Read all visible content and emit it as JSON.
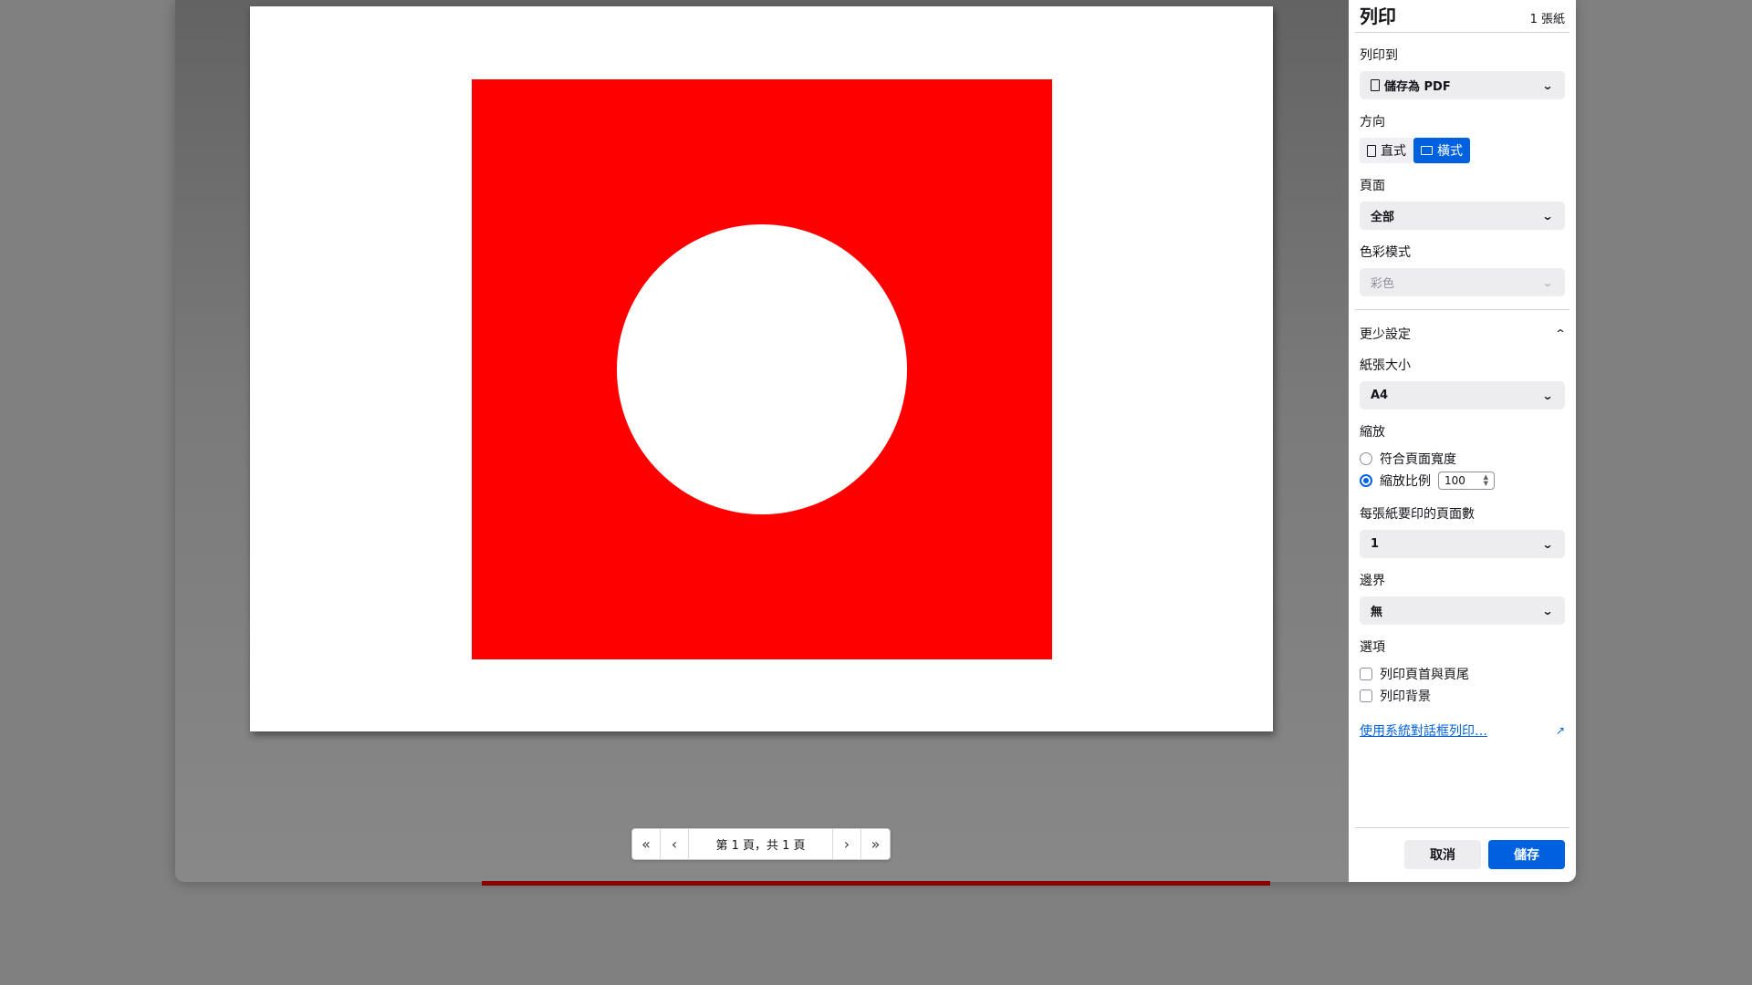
{
  "dialog": {
    "title": "列印",
    "sheet_count": "1 張紙"
  },
  "destination": {
    "label": "列印到",
    "value": "儲存為 PDF"
  },
  "orientation": {
    "label": "方向",
    "portrait": "直式",
    "landscape": "橫式",
    "selected": "landscape"
  },
  "pages": {
    "label": "頁面",
    "value": "全部"
  },
  "color_mode": {
    "label": "色彩模式",
    "value": "彩色"
  },
  "more_settings": {
    "label": "更少設定"
  },
  "paper_size": {
    "label": "紙張大小",
    "value": "A4"
  },
  "scale": {
    "label": "縮放",
    "fit_option": "符合頁面寬度",
    "scale_option": "縮放比例",
    "scale_value": "100",
    "selected": "scale"
  },
  "pages_per_sheet": {
    "label": "每張紙要印的頁面數",
    "value": "1"
  },
  "margins": {
    "label": "邊界",
    "value": "無"
  },
  "options": {
    "label": "選項",
    "headers_footers": "列印頁首與頁尾",
    "backgrounds": "列印背景"
  },
  "system_dialog_link": "使用系統對話框列印…",
  "footer": {
    "cancel": "取消",
    "save": "儲存"
  },
  "pager": {
    "label": "第 1 頁，共 1 頁",
    "first": "«",
    "prev": "‹",
    "next": "›",
    "last": "»"
  },
  "colors": {
    "accent": "#0061e0",
    "preview_square": "#ff0000",
    "preview_circle": "#ffffff"
  }
}
